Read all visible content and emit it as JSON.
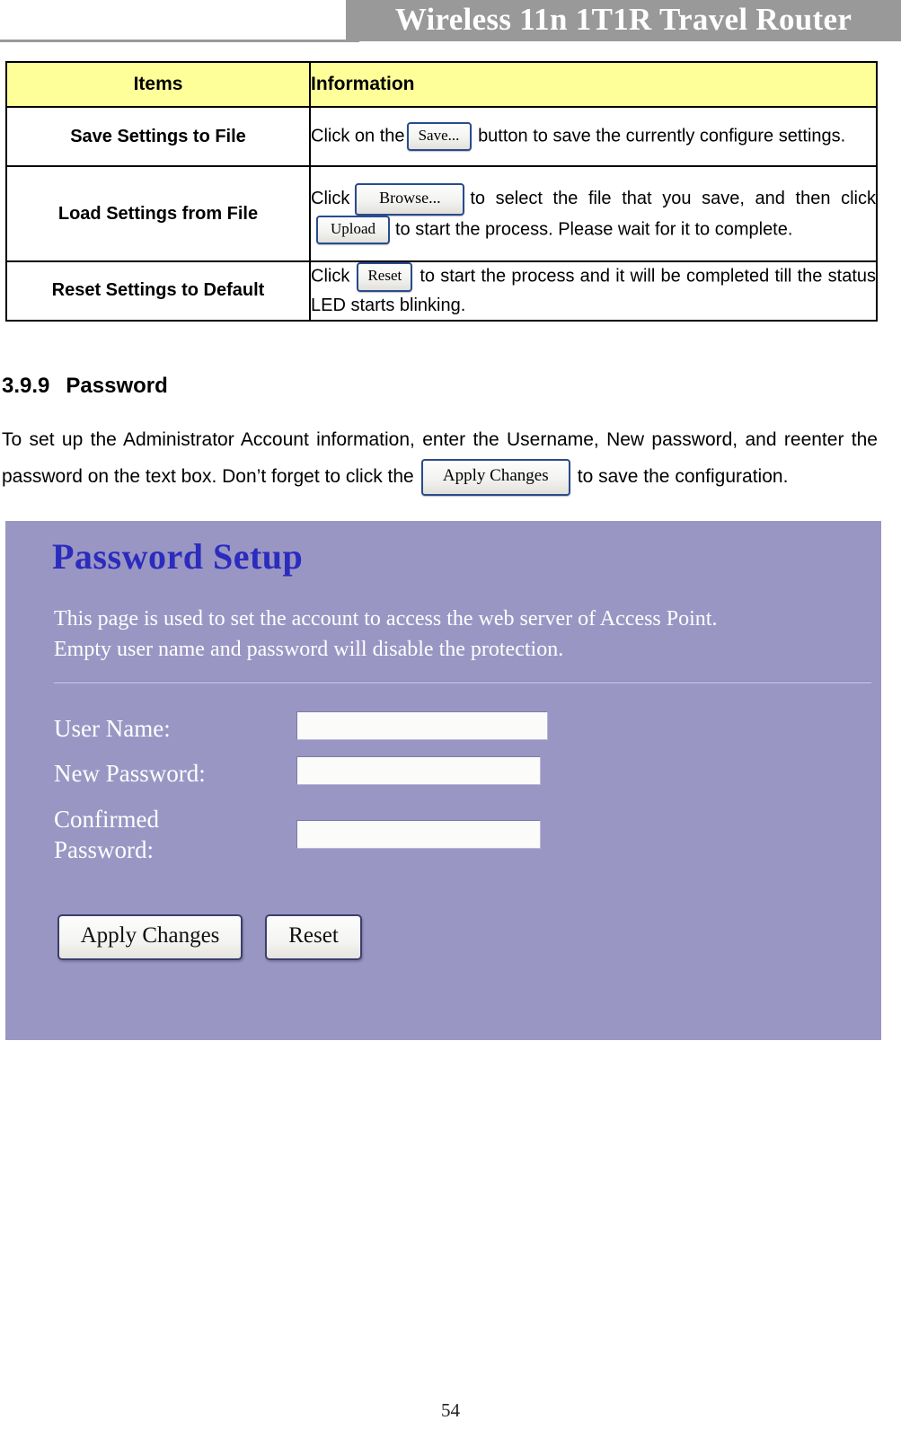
{
  "header": {
    "title": "Wireless 11n 1T1R Travel Router"
  },
  "info_table": {
    "columns": [
      "Items",
      "Information"
    ],
    "rows": [
      {
        "item": "Save Settings to File",
        "text_before": "Click on the",
        "button": "Save...",
        "text_after": "button to save the currently configure settings."
      },
      {
        "item": "Load Settings from File",
        "text_before": "Click",
        "button": "Browse...",
        "text_middle": "to select the file that you save, and then click",
        "button2": "Upload",
        "text_after": "to start the process. Please wait for it to complete."
      },
      {
        "item": "Reset Settings to Default",
        "text_before": "Click",
        "button": "Reset",
        "text_after": "to start the process and it will be completed till the status LED starts blinking."
      }
    ]
  },
  "section": {
    "number": "3.9.9",
    "title": "Password",
    "paragraph_part1": "To set up the Administrator Account information, enter the Username, New password, and reenter the password on the text box. Don’t forget to click the",
    "inline_button": "Apply Changes",
    "paragraph_part2": "to save the configuration."
  },
  "screenshot": {
    "title": "Password Setup",
    "description_line1": "This page is used to set the account to access the web server of Access Point.",
    "description_line2": "Empty user name and password will disable the protection.",
    "fields": [
      {
        "label": "User Name:",
        "value": "",
        "placeholder": ""
      },
      {
        "label": "New Password:",
        "value": "",
        "placeholder": ""
      },
      {
        "label_line1": "Confirmed",
        "label_line2": "Password:",
        "value": "",
        "placeholder": ""
      }
    ],
    "buttons": {
      "apply": "Apply Changes",
      "reset": "Reset"
    },
    "colors": {
      "panel_background": "#9a96c4",
      "title_color": "#2b2bbd",
      "label_color": "#ffffff"
    }
  },
  "footer": {
    "page_number": "54"
  }
}
